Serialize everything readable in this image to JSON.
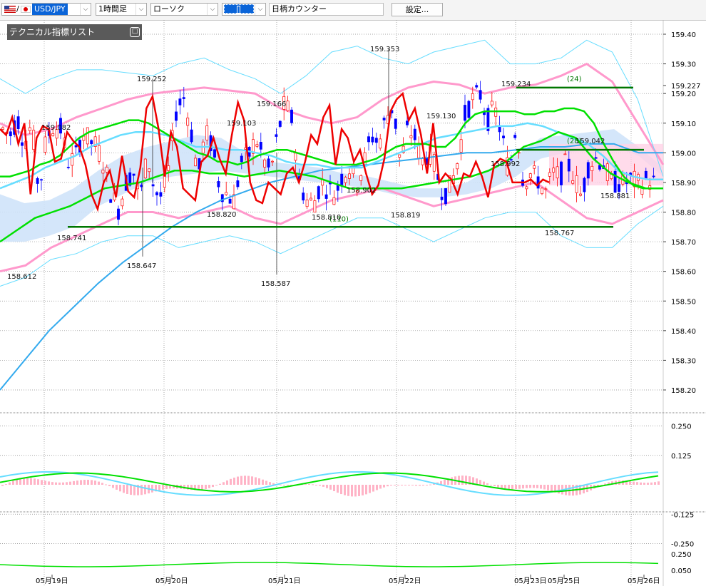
{
  "toolbar": {
    "symbol": "USD/JPY",
    "timeframe": "1時間足",
    "chart_style": "ローソク",
    "counter": "日柄カウンター",
    "settings": "設定..."
  },
  "panel": {
    "title": "テクニカル指標リスト",
    "button": "□"
  },
  "price_axis": {
    "ticks": [
      "159.40",
      "159.30",
      "159.227",
      "159.20",
      "159.10",
      "159.00",
      "158.90",
      "158.80",
      "158.70",
      "158.60",
      "158.50",
      "158.40",
      "158.30",
      "158.20"
    ]
  },
  "macd_axis": {
    "ticks": [
      "0.250",
      "0.125",
      "-0.125",
      "-0.250"
    ]
  },
  "osc_axis": {
    "ticks": [
      "0.250",
      "0.050"
    ]
  },
  "date_axis": {
    "labels": [
      "05月19日",
      "05月20日",
      "05月21日",
      "05月22日",
      "05月23日",
      "05月25日",
      "05月26日"
    ]
  },
  "annotations": {
    "price_labels": [
      "159.082",
      "158.612",
      "158.741",
      "158.647",
      "159.252",
      "158.820",
      "159.103",
      "159.166",
      "158.587",
      "158.810",
      "158.902",
      "159.353",
      "158.819",
      "159.130",
      "159.234",
      "158.992",
      "159.042",
      "158.881",
      "158.767"
    ],
    "counts": [
      "(24)",
      "(28)",
      "(110)"
    ]
  },
  "colors": {
    "bg": "#ffffff",
    "grid": "#888888",
    "up_candle": "#ff0000",
    "down_candle": "#0000ff",
    "red_line": "#ee0000",
    "green_line": "#00e000",
    "cyan_line": "#66ddff",
    "pink_band": "#ff99cc",
    "long_ma": "#33aaee",
    "hline": "#007700"
  },
  "chart_data": {
    "type": "line",
    "yrange": [
      158.15,
      159.44
    ],
    "series": [
      {
        "values": [
          159.08,
          159.06,
          159.12,
          159.03,
          159.1,
          158.86,
          159.05,
          159.09,
          159.08,
          158.97,
          158.98,
          159.07,
          159.04,
          159.02,
          158.96,
          158.86,
          158.81,
          158.9,
          158.94,
          158.85,
          158.99,
          158.87,
          158.85,
          158.95,
          159.15,
          159.19,
          159.08,
          158.92,
          159.07,
          159.02,
          158.88,
          158.86,
          158.84,
          158.97,
          158.99,
          159.05,
          158.98,
          158.93,
          159.06,
          159.17,
          159.11,
          158.9,
          158.84,
          158.83,
          158.9,
          158.88,
          158.86,
          158.93,
          158.95,
          158.9,
          158.97,
          159.06,
          159.03,
          159.12,
          159.16,
          158.96,
          159.08,
          159.05,
          158.97,
          159.01,
          158.93,
          158.86,
          158.89,
          158.98,
          159.14,
          159.18,
          159.2,
          159.11,
          159.15,
          159.06,
          158.93,
          159.1,
          158.9,
          158.93,
          158.91,
          158.86,
          158.93,
          158.92,
          158.97,
          158.92,
          158.85,
          158.96,
          158.98,
          158.97,
          158.9,
          158.9,
          158.9,
          158.91,
          158.89,
          158.91,
          158.9
        ]
      },
      {
        "values": [
          158.92,
          158.92,
          158.93,
          158.94,
          158.96,
          158.97,
          158.99,
          159.02,
          159.05,
          159.07,
          159.08,
          159.09,
          159.1,
          159.11,
          159.11,
          159.1,
          159.08,
          159.06,
          159.04,
          159.02,
          159.0,
          158.99,
          158.97,
          158.97,
          158.96,
          158.97,
          158.99,
          159.0,
          159.01,
          159.01,
          159.0,
          158.99,
          158.98,
          158.97,
          158.96,
          158.96,
          158.96,
          158.97,
          158.98,
          159.0,
          159.02,
          159.03,
          159.03,
          159.03,
          159.02,
          159.02,
          159.05,
          159.1,
          159.13,
          159.14,
          159.14,
          159.14,
          159.14,
          159.13,
          159.13,
          159.14,
          159.14,
          159.15,
          159.15,
          159.14,
          159.1,
          159.03,
          158.97,
          158.92,
          158.89,
          158.88,
          158.88,
          158.88
        ]
      },
      {
        "values": [
          158.88,
          158.9,
          158.92,
          158.95,
          158.97,
          158.99,
          159.02,
          159.04,
          159.06,
          159.07,
          159.07,
          159.06,
          159.04,
          159.02,
          159.02,
          159.01,
          159.01,
          159.0,
          158.99,
          158.97,
          158.96,
          158.96,
          158.95,
          158.95,
          158.95,
          158.97,
          158.99,
          159.01,
          159.03,
          159.05,
          159.06,
          159.07,
          159.08,
          159.09,
          159.09,
          159.1,
          159.09,
          159.07,
          159.05,
          159.03,
          158.99,
          158.94,
          158.92,
          158.91,
          158.91
        ]
      },
      {
        "values": [
          158.2,
          158.3,
          158.4,
          158.48,
          158.56,
          158.63,
          158.69,
          158.75,
          158.8,
          158.84,
          158.87,
          158.9,
          158.92,
          158.94,
          158.95,
          158.96,
          158.97,
          158.98,
          158.99,
          159.0,
          159.0,
          159.01,
          159.02,
          159.02,
          159.03,
          159.03,
          159.0,
          159.0
        ]
      }
    ],
    "horizontal_lines": [
      {
        "label": "(24)",
        "y": 159.22
      },
      {
        "label": "(28)",
        "y": 159.01
      },
      {
        "label": "(110)",
        "y": 158.75
      }
    ]
  }
}
